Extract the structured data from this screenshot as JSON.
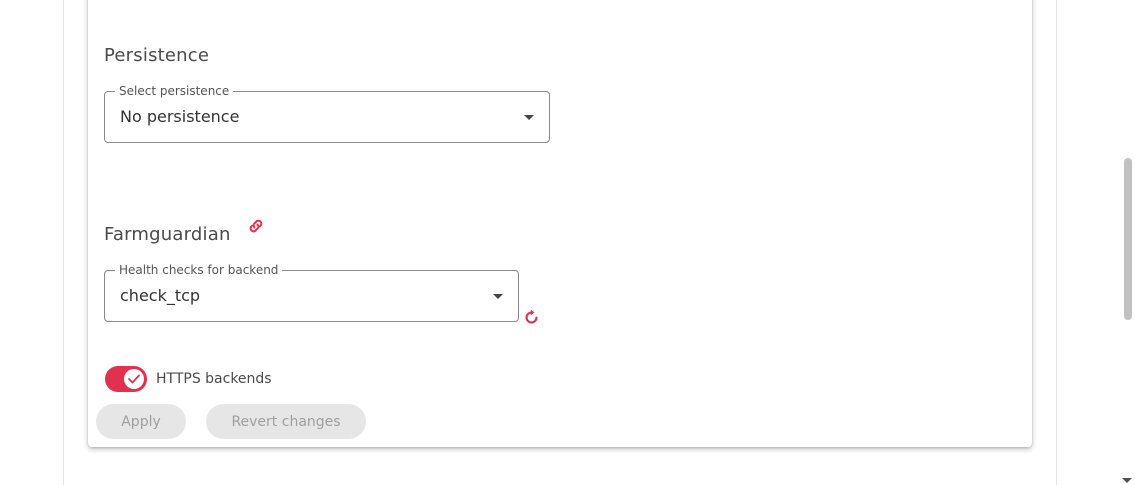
{
  "persistence": {
    "title": "Persistence",
    "select_legend": "Select persistence",
    "select_value": "No persistence"
  },
  "farmguardian": {
    "title": "Farmguardian",
    "link_icon": "link-icon",
    "select_legend": "Health checks for backend",
    "select_value": "check_tcp",
    "refresh_icon": "refresh-icon"
  },
  "https_backends": {
    "label": "HTTPS backends",
    "enabled": true
  },
  "actions": {
    "apply_label": "Apply",
    "revert_label": "Revert changes"
  },
  "colors": {
    "accent": "#e0324f",
    "disabled_button_bg": "#e6e6e6",
    "disabled_button_text": "#9f9f9f"
  }
}
